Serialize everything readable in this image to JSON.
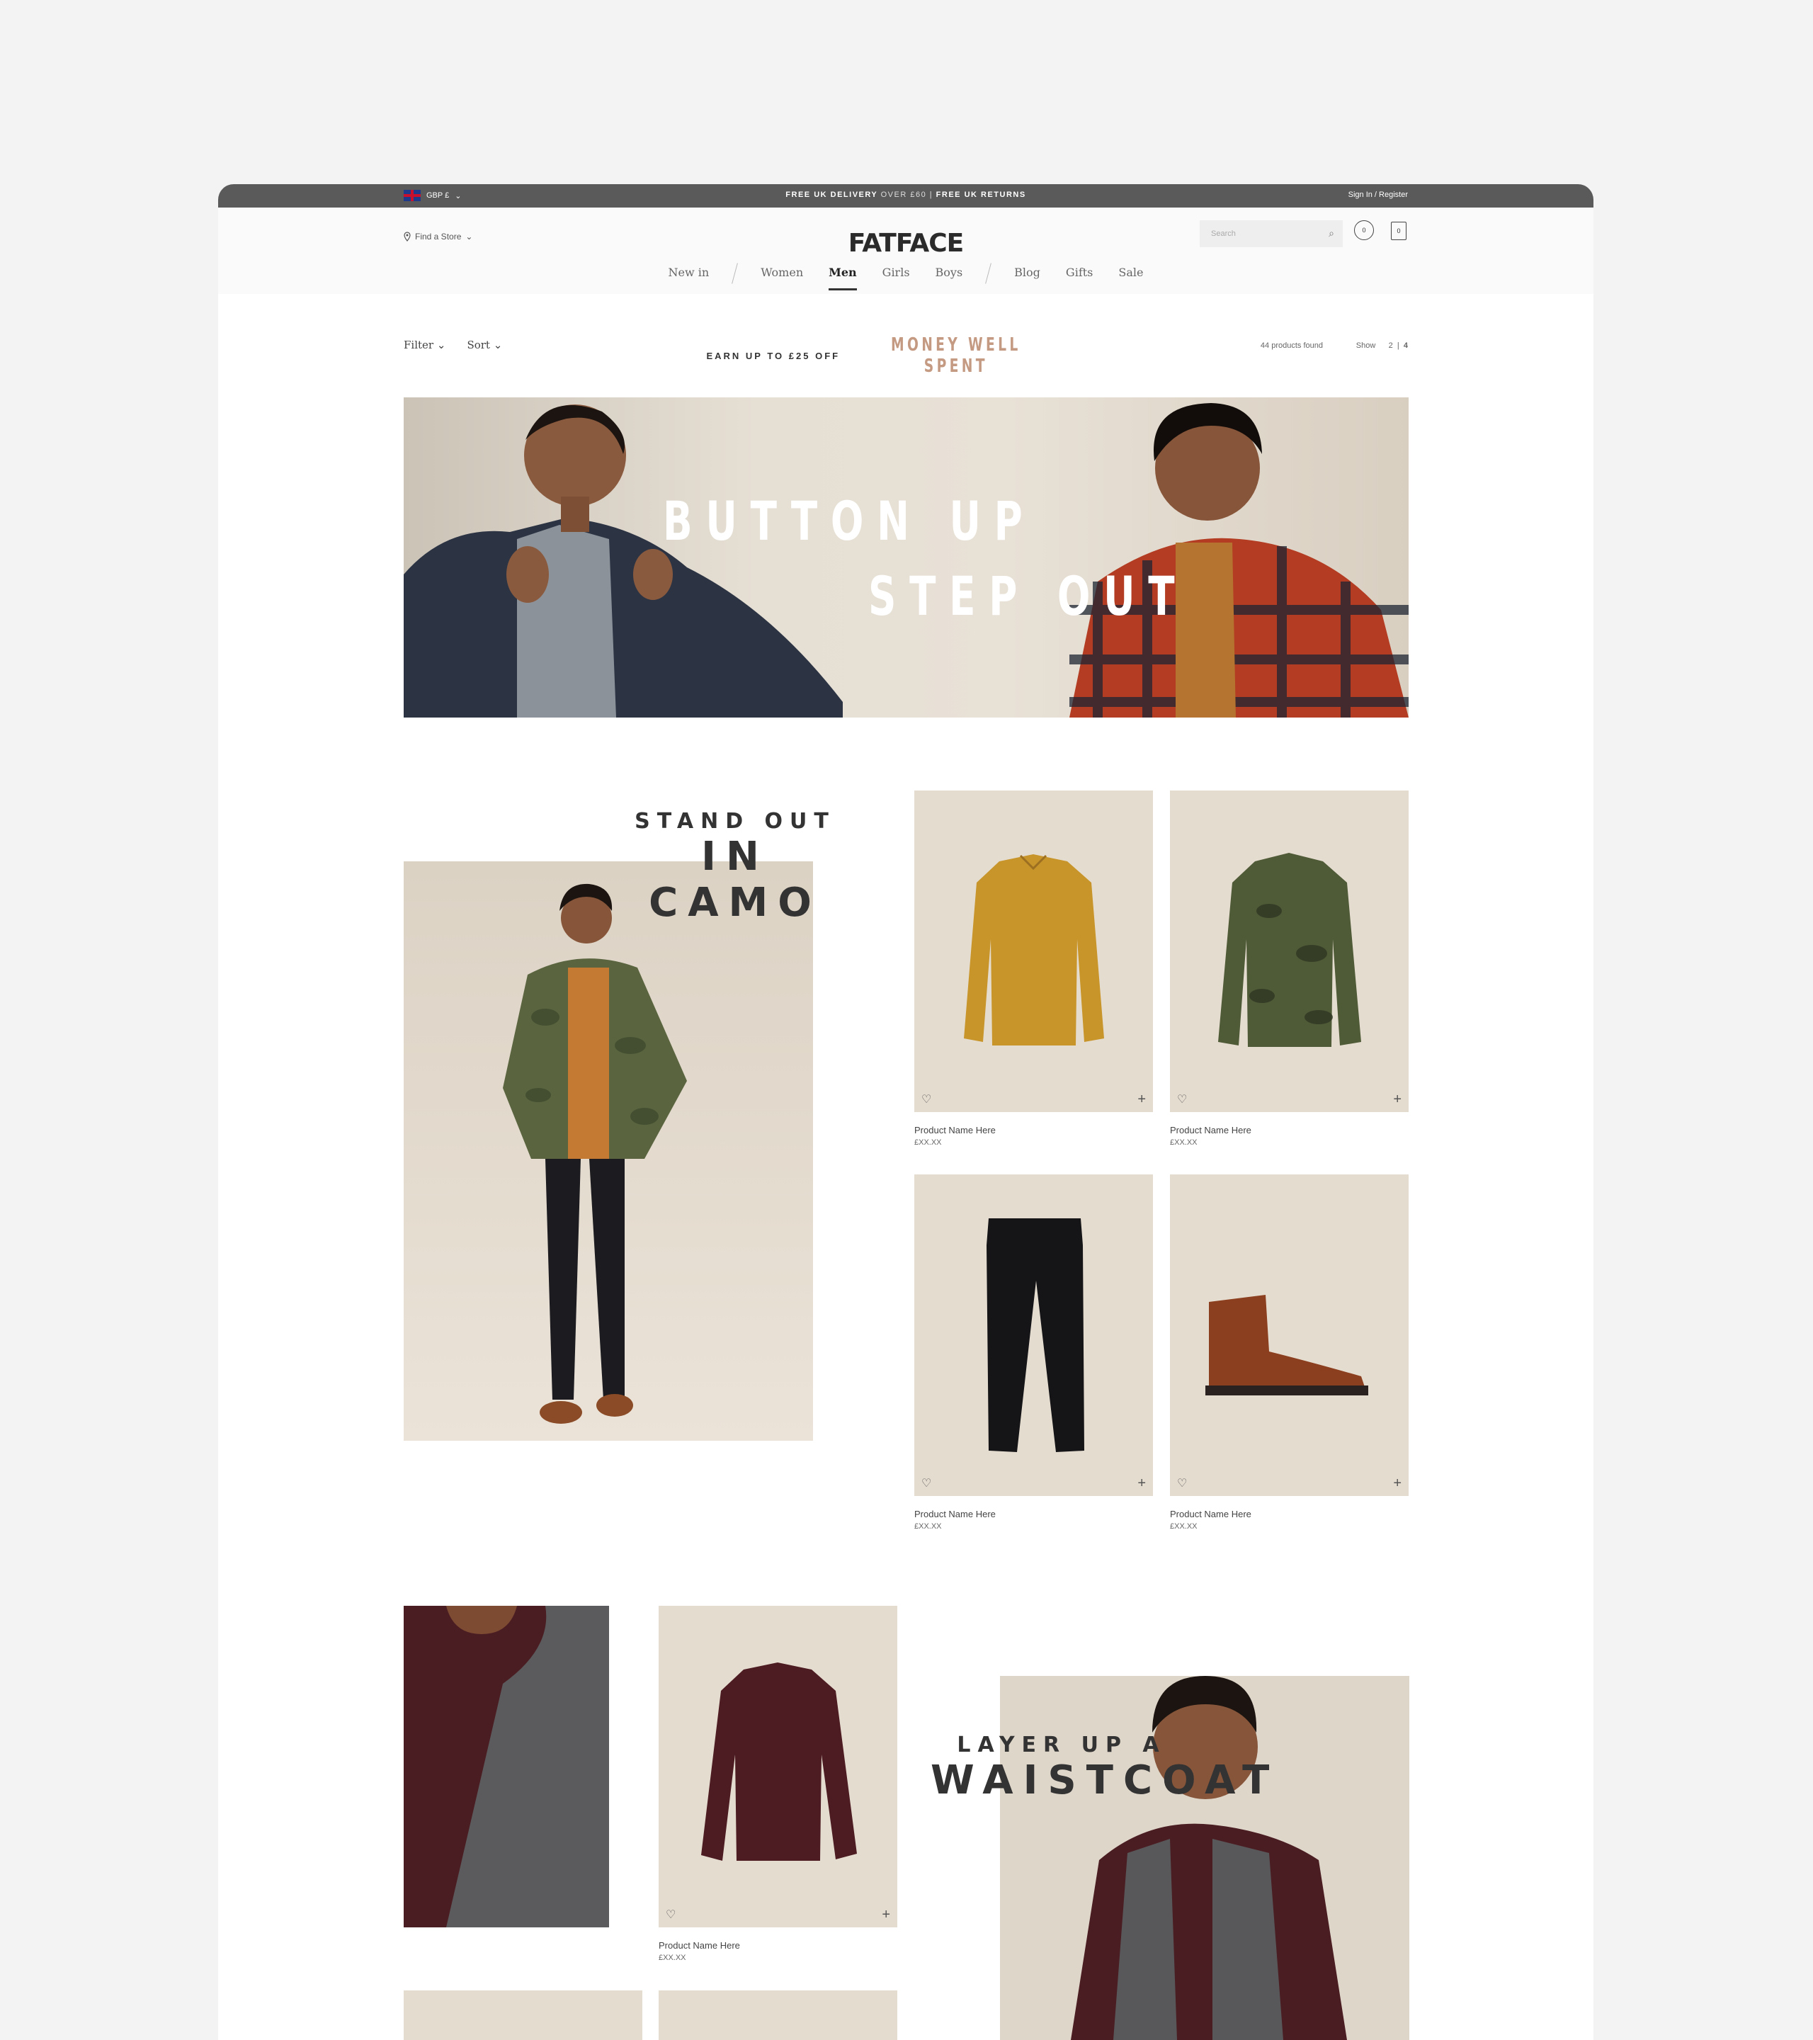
{
  "topbar": {
    "currency": "GBP £",
    "delivery_bold": "FREE UK DELIVERY",
    "delivery_light": "OVER £60 |",
    "returns": "FREE UK RETURNS",
    "signin": "Sign In / Register"
  },
  "header": {
    "find_store": "Find a Store",
    "logo": "FATFACE",
    "search_placeholder": "Search",
    "wishlist_count": "0",
    "bag_count": "0"
  },
  "nav": {
    "new_in": "New in",
    "women": "Women",
    "men": "Men",
    "girls": "Girls",
    "boys": "Boys",
    "blog": "Blog",
    "gifts": "Gifts",
    "sale": "Sale"
  },
  "toolbar": {
    "filter": "Filter",
    "sort": "Sort",
    "promo_earn": "EARN UP TO £25 OFF",
    "promo_money": "MONEY WELL SPENT",
    "count": "44 products found",
    "show_label": "Show",
    "show_2": "2",
    "show_4": "4"
  },
  "hero": {
    "line1": "BUTTON UP",
    "line2": "STEP OUT"
  },
  "camo": {
    "small": "STAND OUT",
    "big": "IN CAMO"
  },
  "waistcoat": {
    "small": "LAYER UP A",
    "big": "WAISTCOAT"
  },
  "products": [
    {
      "name": "Product Name Here",
      "price": "£XX.XX",
      "icon": "yellow-shirt"
    },
    {
      "name": "Product Name Here",
      "price": "£XX.XX",
      "icon": "camo-jacket"
    },
    {
      "name": "Product Name Here",
      "price": "£XX.XX",
      "icon": "black-jeans"
    },
    {
      "name": "Product Name Here",
      "price": "£XX.XX",
      "icon": "brown-boot"
    },
    {
      "name": "Product Name Here",
      "price": "£XX.XX",
      "icon": "check-shirt"
    }
  ],
  "colors": {
    "topbar": "#5a5a5a",
    "promo_accent": "#c49a82",
    "product_bg": "#e5dcd0"
  }
}
